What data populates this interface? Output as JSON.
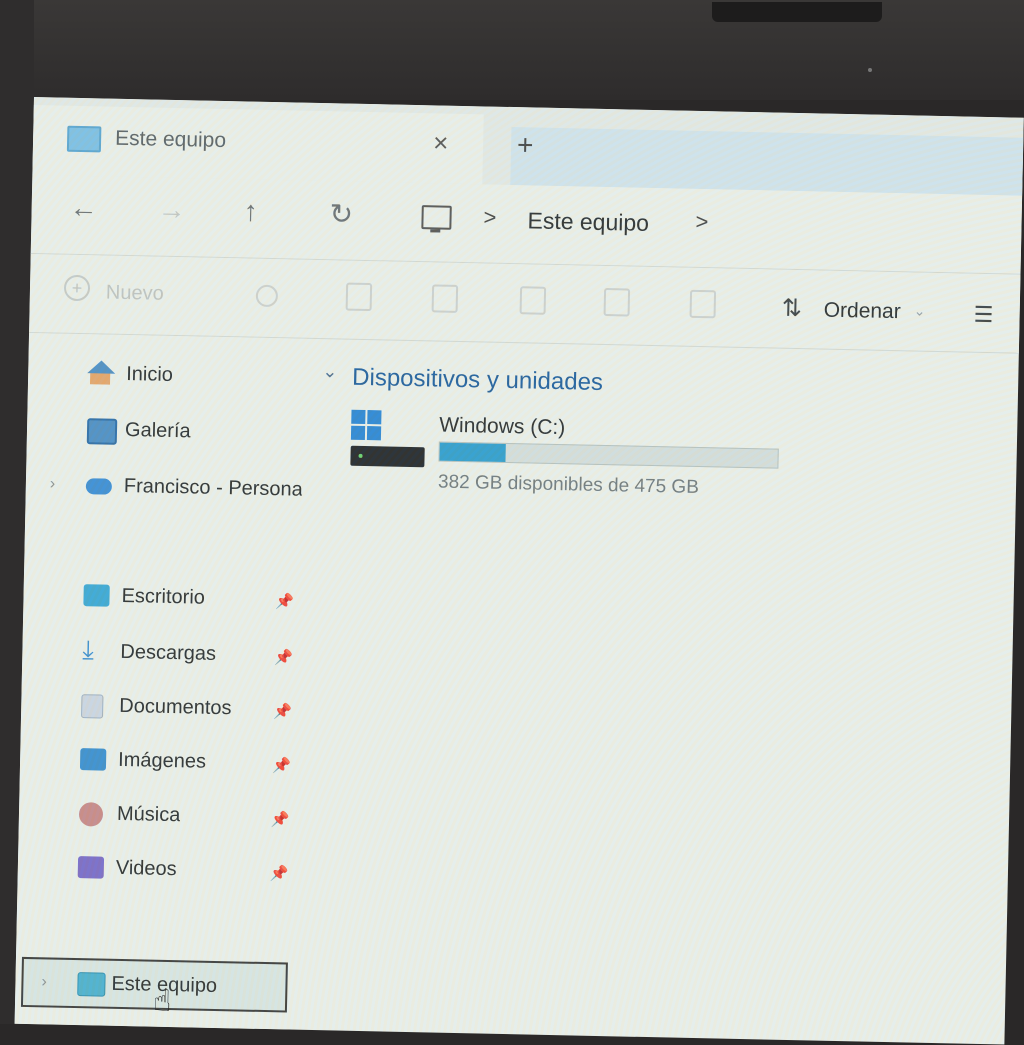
{
  "window": {
    "tab_title": "Este equipo",
    "close_glyph": "×",
    "new_tab_glyph": "+"
  },
  "address_bar": {
    "back_glyph": "←",
    "forward_glyph": "→",
    "up_glyph": "↑",
    "refresh_glyph": "↻",
    "separator": ">",
    "breadcrumb": "Este equipo"
  },
  "command_bar": {
    "new_label": "Nuevo",
    "sort_label": "Ordenar",
    "sort_glyph": "⇅",
    "view_glyph": "☰",
    "icons": [
      "cut-icon",
      "copy-icon",
      "paste-icon",
      "rename-icon",
      "share-icon",
      "delete-icon"
    ]
  },
  "sidebar": {
    "items": [
      {
        "label": "Inicio",
        "icon": "home-icon"
      },
      {
        "label": "Galería",
        "icon": "gallery-icon"
      },
      {
        "label": "Francisco - Persona",
        "icon": "onedrive-icon"
      },
      {
        "label": "Escritorio",
        "icon": "desktop-icon",
        "pinned": true
      },
      {
        "label": "Descargas",
        "icon": "downloads-icon",
        "pinned": true
      },
      {
        "label": "Documentos",
        "icon": "documents-icon",
        "pinned": true
      },
      {
        "label": "Imágenes",
        "icon": "pictures-icon",
        "pinned": true
      },
      {
        "label": "Música",
        "icon": "music-icon",
        "pinned": true
      },
      {
        "label": "Videos",
        "icon": "videos-icon",
        "pinned": true
      },
      {
        "label": "Este equipo",
        "icon": "this-pc-icon",
        "selected": true
      }
    ]
  },
  "main": {
    "section_title": "Dispositivos y unidades",
    "drive": {
      "name": "Windows (C:)",
      "free_text": "382 GB disponibles de 475 GB",
      "used_fraction": 0.196
    }
  },
  "colors": {
    "accent": "#1f5f9e",
    "usage_bar": "#2f9fcf"
  }
}
